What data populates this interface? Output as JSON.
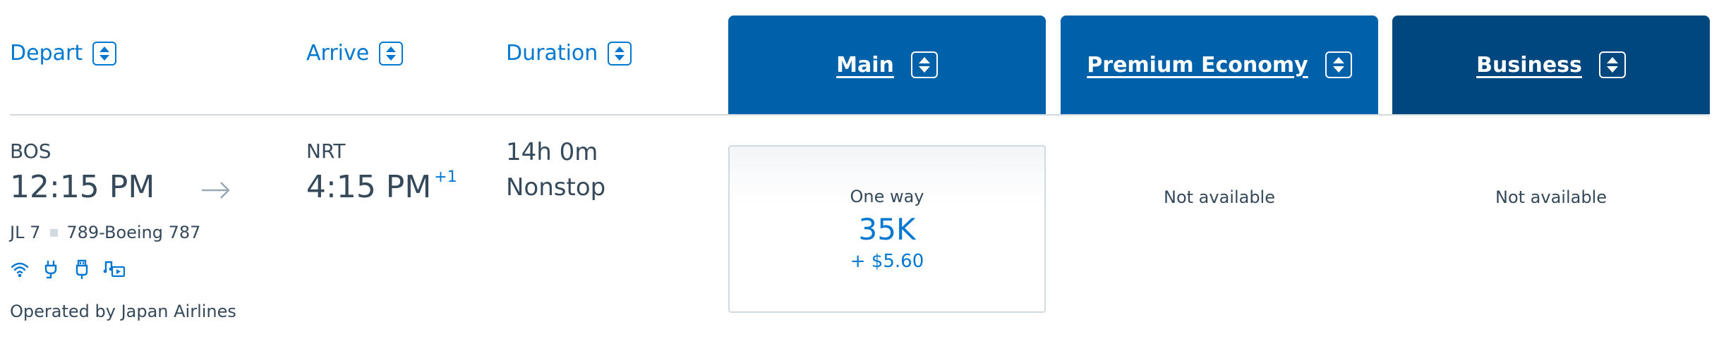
{
  "columns": {
    "depart": "Depart",
    "arrive": "Arrive",
    "duration": "Duration"
  },
  "cabins": [
    {
      "label": "Main",
      "color": "#0061ab"
    },
    {
      "label": "Premium Economy",
      "color": "#0061ab"
    },
    {
      "label": "Business",
      "color": "#00467f"
    }
  ],
  "flight": {
    "origin_code": "BOS",
    "depart_time": "12:15 PM",
    "dest_code": "NRT",
    "arrive_time": "4:15 PM",
    "day_offset": "+1",
    "flight_number": "JL 7",
    "aircraft": "789-Boeing 787",
    "amenities": [
      "wifi-icon",
      "power-outlet-icon",
      "usb-icon",
      "entertainment-icon"
    ],
    "operated_by": "Operated by Japan Airlines",
    "duration": "14h 0m",
    "stops": "Nonstop"
  },
  "fares": {
    "main": {
      "trip_type": "One way",
      "miles": "35K",
      "fees": "+ $5.60"
    },
    "premium_economy": {
      "status": "Not available"
    },
    "business": {
      "status": "Not available"
    }
  },
  "colors": {
    "accent": "#0078d2",
    "text": "#36495a",
    "divider": "#d0dae0"
  }
}
